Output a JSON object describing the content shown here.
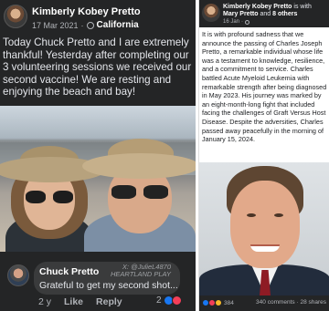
{
  "left_post": {
    "author": "Kimberly Kobey Pretto",
    "date": "17 Mar 2021",
    "separator": "·",
    "location": "California",
    "body": "Today Chuck Pretto and  I are extremely thankful! Yesterday after completing our 3 volunteering sessions we received our second vaccine! We are resting and enjoying the beach and bay!",
    "comment": {
      "author": "Chuck Pretto",
      "text": "Grateful to get my second shot...",
      "watermark": "X: @JulieL4870\nHEARTLAND PLAY",
      "age": "2 y",
      "like_label": "Like",
      "reply_label": "Reply",
      "reaction_count": "2"
    }
  },
  "right_post": {
    "author": "Kimberly Kobey Pretto",
    "is_with": "is with",
    "with_name": "Mary Pretto",
    "and_label": "and",
    "others": "8 others",
    "date": "16 Jan",
    "body": "It is with profound sadness that we announce the passing of Charles Joseph Pretto, a remarkable individual whose life was a testament to knowledge, resilience, and a commitment to service. Charles battled Acute Myeloid Leukemia with remarkable strength after being diagnosed in May 2023. His journey was marked by an eight-month-long fight that included facing the challenges of Graft Versus Host Disease. Despite the adversities, Charles passed away peacefully in the morning of January 15, 2024.",
    "reaction_count": "384",
    "stats": "340 comments · 28 shares"
  },
  "icons": {
    "left_privacy": "globe-icon",
    "like": "like-reaction-icon",
    "love": "love-reaction-icon",
    "care": "care-reaction-icon"
  },
  "colors": {
    "dark_bg": "#242526",
    "bubble_bg": "#3a3b3c",
    "light_text": "#e4e6eb",
    "muted_text": "#b0b3b8",
    "like_blue": "#1877f2",
    "love_red": "#f33e58"
  }
}
